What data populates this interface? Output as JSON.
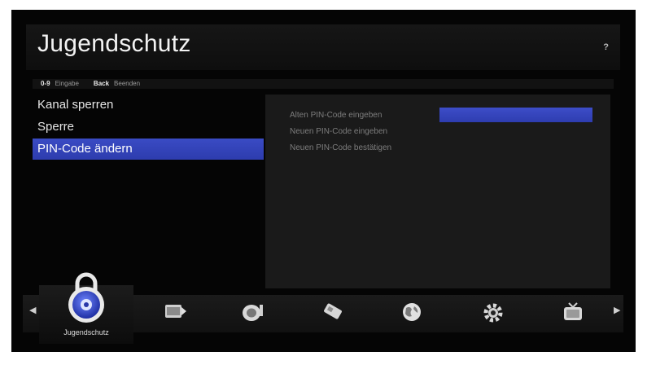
{
  "header": {
    "title": "Jugendschutz",
    "help_label": "?"
  },
  "keyhints": [
    {
      "key": "0-9",
      "label": "Eingabe"
    },
    {
      "key": "Back",
      "label": "Beenden"
    }
  ],
  "menu": {
    "items": [
      {
        "label": "Kanal sperren",
        "selected": false
      },
      {
        "label": "Sperre",
        "selected": false
      },
      {
        "label": "PIN-Code ändern",
        "selected": true
      }
    ]
  },
  "pin_panel": {
    "fields": [
      {
        "label": "Alten PIN-Code eingeben",
        "value": ""
      },
      {
        "label": "Neuen PIN-Code eingeben",
        "value": ""
      },
      {
        "label": "Neuen PIN-Code bestätigen",
        "value": ""
      }
    ]
  },
  "category_bar": {
    "active_label": "Jugendschutz",
    "icons": [
      "lock-icon",
      "media-folder-icon",
      "satellite-dish-icon",
      "card-icon",
      "globe-icon",
      "gear-icon",
      "tv-icon"
    ]
  },
  "colors": {
    "accent": "#2f3fb3",
    "background": "#050505",
    "panel": "#1a1a1a"
  }
}
